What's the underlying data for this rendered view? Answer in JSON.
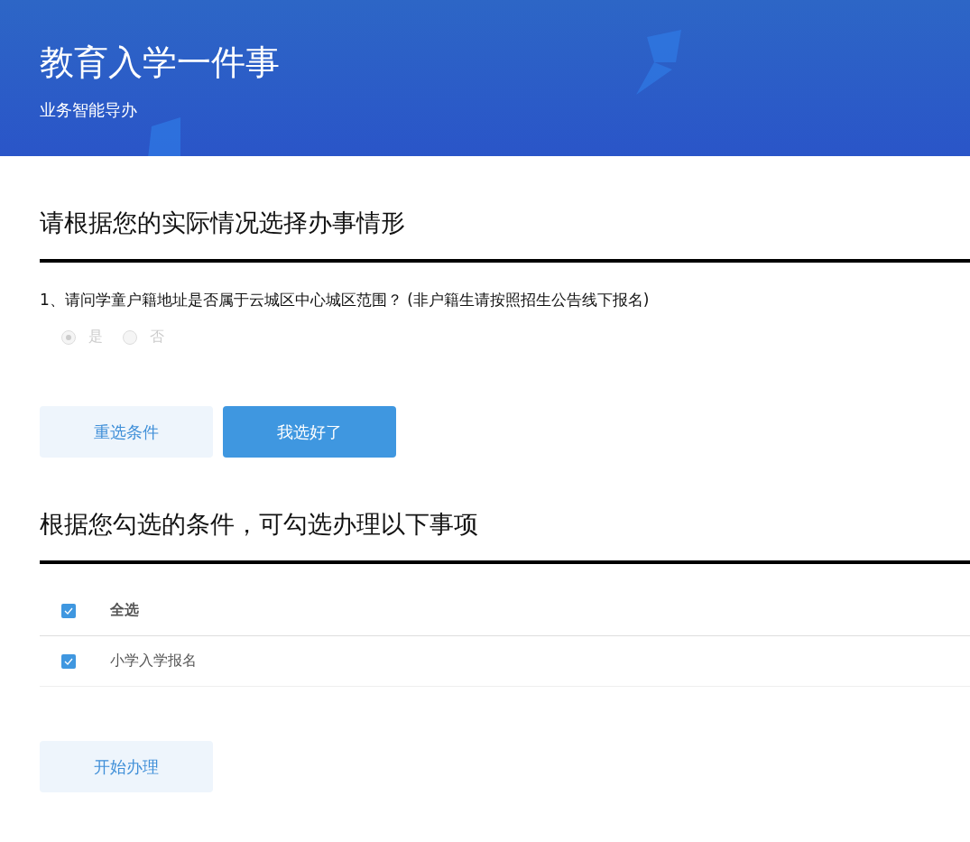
{
  "banner": {
    "title": "教育入学一件事",
    "subtitle": "业务智能导办"
  },
  "conditions": {
    "heading": "请根据您的实际情况选择办事情形",
    "questions": [
      {
        "text": "1、请问学童户籍地址是否属于云城区中心城区范围？ (非户籍生请按照招生公告线下报名)",
        "disabled": true,
        "options": [
          {
            "label": "是",
            "selected": true
          },
          {
            "label": "否",
            "selected": false
          }
        ]
      }
    ],
    "buttons": [
      {
        "label": "重选条件",
        "kind": "secondary"
      },
      {
        "label": "我选好了",
        "kind": "primary"
      }
    ]
  },
  "matters": {
    "heading": "根据您勾选的条件，可勾选办理以下事项",
    "header": {
      "label": "全选",
      "checked": true
    },
    "items": [
      {
        "label": "小学入学报名",
        "checked": true
      }
    ],
    "button": {
      "label": "开始办理"
    }
  }
}
